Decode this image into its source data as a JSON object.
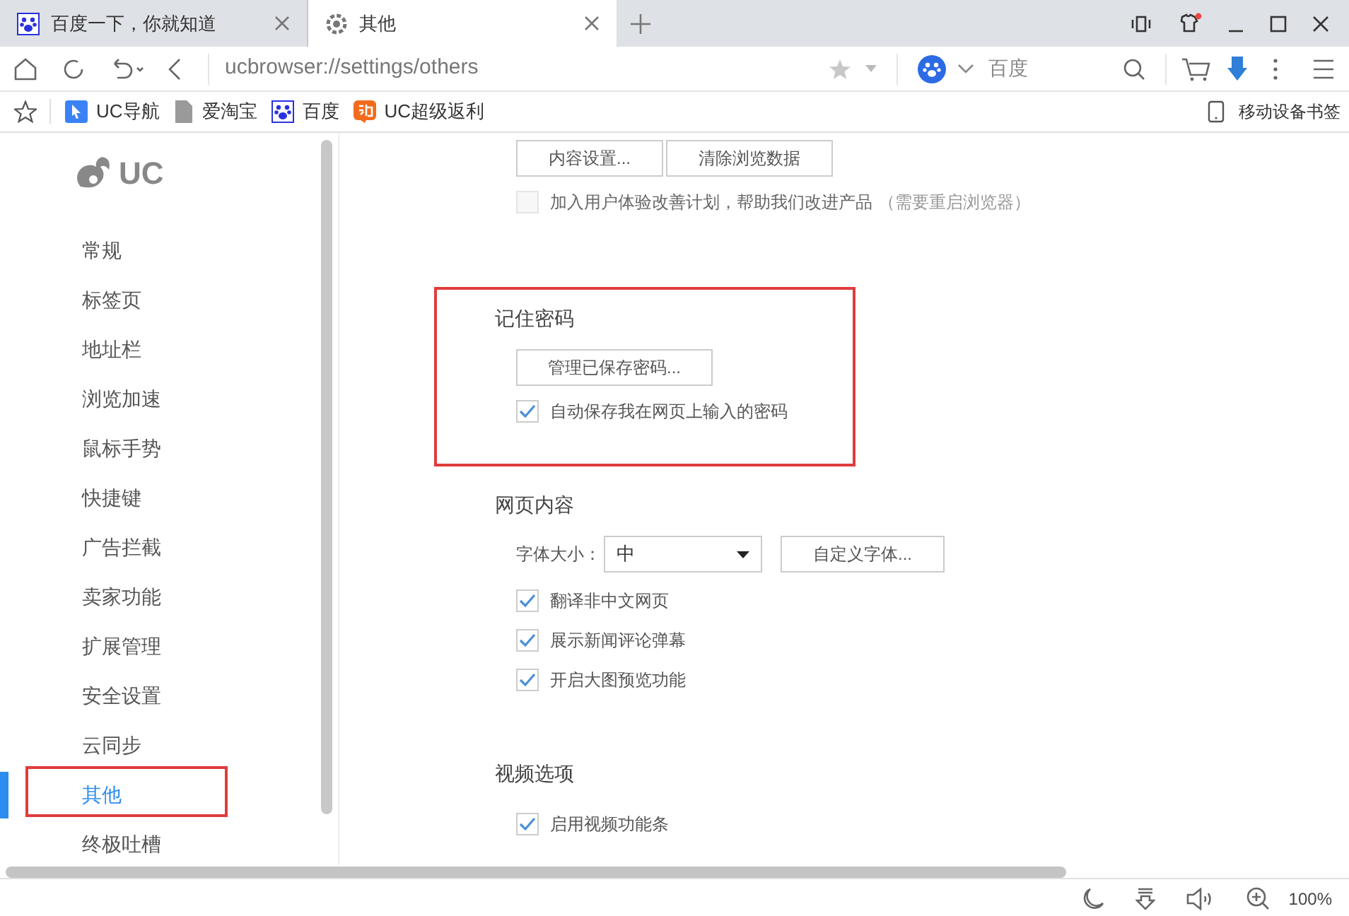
{
  "tabs": [
    {
      "title": "百度一下，你就知道",
      "selected": false
    },
    {
      "title": "其他",
      "selected": true
    }
  ],
  "toolbar": {
    "url": "ucbrowser://settings/others",
    "search_engine": "百度"
  },
  "bookmarks": [
    {
      "label": "UC导航"
    },
    {
      "label": "爱淘宝"
    },
    {
      "label": "百度"
    },
    {
      "label": "UC超级返利"
    }
  ],
  "mobile_bookmarks": "移动设备书签",
  "sidebar": {
    "logo": "UC",
    "items": [
      {
        "label": "常规",
        "selected": false,
        "highlighted": false
      },
      {
        "label": "标签页",
        "selected": false,
        "highlighted": false
      },
      {
        "label": "地址栏",
        "selected": false,
        "highlighted": false
      },
      {
        "label": "浏览加速",
        "selected": false,
        "highlighted": false
      },
      {
        "label": "鼠标手势",
        "selected": false,
        "highlighted": false
      },
      {
        "label": "快捷键",
        "selected": false,
        "highlighted": false
      },
      {
        "label": "广告拦截",
        "selected": false,
        "highlighted": false
      },
      {
        "label": "卖家功能",
        "selected": false,
        "highlighted": false
      },
      {
        "label": "扩展管理",
        "selected": false,
        "highlighted": false
      },
      {
        "label": "安全设置",
        "selected": false,
        "highlighted": false
      },
      {
        "label": "云同步",
        "selected": false,
        "highlighted": false
      },
      {
        "label": "其他",
        "selected": true,
        "highlighted": true
      },
      {
        "label": "终极吐槽",
        "selected": false,
        "highlighted": false
      }
    ]
  },
  "sections": [
    {
      "highlighted": false,
      "rows": [
        {
          "kind": "buttons",
          "buttons": [
            "内容设置...",
            "清除浏览数据"
          ]
        },
        {
          "kind": "checkbox",
          "label": "加入用户体验改善计划，帮助我们改进产品",
          "note": "（需要重启浏览器）",
          "checked": false,
          "disabled": true
        }
      ]
    },
    {
      "title": "记住密码",
      "highlighted": true,
      "rows": [
        {
          "kind": "buttons",
          "buttons": [
            "管理已保存密码..."
          ]
        },
        {
          "kind": "checkbox",
          "label": "自动保存我在网页上输入的密码",
          "checked": true,
          "disabled": false
        }
      ]
    },
    {
      "title": "网页内容",
      "highlighted": false,
      "rows": [
        {
          "kind": "select",
          "label": "字体大小：",
          "value": "中",
          "button": "自定义字体..."
        },
        {
          "kind": "checkbox",
          "label": "翻译非中文网页",
          "checked": true,
          "disabled": false
        },
        {
          "kind": "checkbox",
          "label": "展示新闻评论弹幕",
          "checked": true,
          "disabled": false
        },
        {
          "kind": "checkbox",
          "label": "开启大图预览功能",
          "checked": true,
          "disabled": false
        }
      ]
    },
    {
      "title": "视频选项",
      "highlighted": false,
      "rows": [
        {
          "kind": "checkbox",
          "label": "启用视频功能条",
          "checked": true,
          "disabled": false
        }
      ]
    }
  ],
  "status_bar": {
    "zoom": "100%"
  }
}
